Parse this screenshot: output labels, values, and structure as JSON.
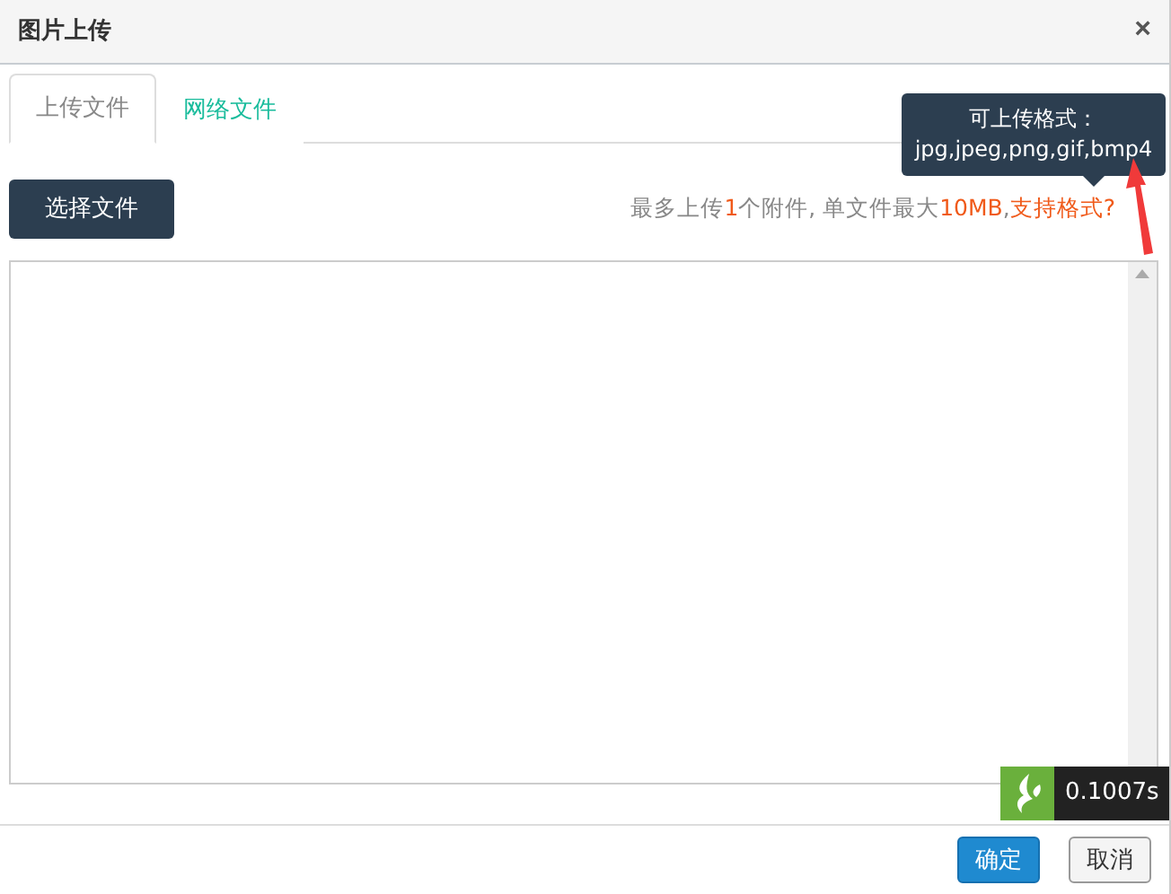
{
  "window": {
    "title": "图片上传",
    "close": "×"
  },
  "tabs": [
    {
      "label": "上传文件",
      "selected": true
    },
    {
      "label": "网络文件",
      "selected": false
    }
  ],
  "choose_button": "选择文件",
  "note": [
    {
      "text": "最多上传",
      "highlight": false
    },
    {
      "text": "1",
      "highlight": true
    },
    {
      "text": "个附件, 单文件最大",
      "highlight": false
    },
    {
      "text": "10MB",
      "highlight": true
    },
    {
      "text": ", ",
      "highlight": false
    }
  ],
  "formats_link": "支持格式?",
  "tooltip": {
    "title": "可上传格式：",
    "formats": "jpg,jpeg,png,gif,bmp4"
  },
  "footer_buttons": [
    {
      "label": "确定",
      "kind": "primary"
    },
    {
      "label": "取消",
      "kind": "default"
    }
  ],
  "debug_badge": {
    "time": "0.1007s"
  }
}
